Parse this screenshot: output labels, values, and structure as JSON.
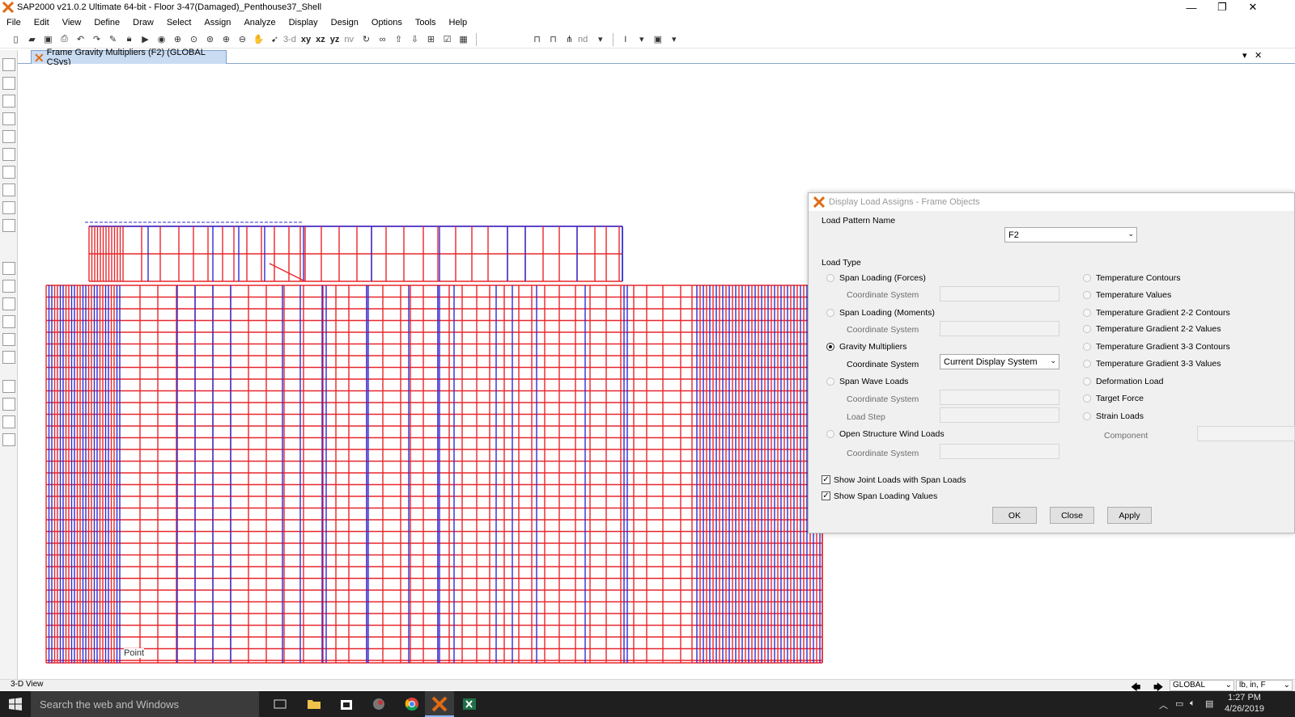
{
  "window": {
    "title": "SAP2000 v21.0.2 Ultimate 64-bit - Floor 3-47(Damaged)_Penthouse37_Shell",
    "minimize": "—",
    "restore": "❐",
    "close": "✕"
  },
  "menu": [
    "File",
    "Edit",
    "View",
    "Define",
    "Draw",
    "Select",
    "Assign",
    "Analyze",
    "Display",
    "Design",
    "Options",
    "Tools",
    "Help"
  ],
  "toolbar": {
    "view_3d": "3-d",
    "view_xy": "xy",
    "view_xz": "xz",
    "view_yz": "yz",
    "view_nv": "nv",
    "nd_label": "nd"
  },
  "tab": {
    "label": "Frame Gravity Multipliers (F2) (GLOBAL CSys)",
    "dropdown": "▾",
    "close": "✕"
  },
  "canvas": {
    "point_label": "Point"
  },
  "dialog": {
    "title": "Display Load Assigns - Frame Objects",
    "load_pattern_label": "Load Pattern Name",
    "load_pattern_value": "F2",
    "load_type_label": "Load Type",
    "span_forces": "Span Loading (Forces)",
    "span_moments": "Span Loading (Moments)",
    "gravity": "Gravity Multipliers",
    "span_wave": "Span Wave Loads",
    "open_wind": "Open Structure Wind Loads",
    "coord_system": "Coordinate System",
    "load_step": "Load Step",
    "coord_value": "Current Display System",
    "temp_contours": "Temperature Contours",
    "temp_values": "Temperature Values",
    "tg22_contours": "Temperature Gradient 2-2 Contours",
    "tg22_values": "Temperature Gradient 2-2 Values",
    "tg33_contours": "Temperature Gradient 3-3 Contours",
    "tg33_values": "Temperature Gradient 3-3 Values",
    "deformation": "Deformation Load",
    "target_force": "Target Force",
    "strain": "Strain Loads",
    "component": "Component",
    "show_joint": "Show Joint Loads with Span Loads",
    "show_span_values": "Show Span Loading Values",
    "ok": "OK",
    "close": "Close",
    "apply": "Apply"
  },
  "status": {
    "view": "3-D View",
    "coord": "GLOBAL",
    "units": "lb, in, F"
  },
  "taskbar": {
    "search": "Search the web and Windows",
    "time": "1:27 PM",
    "date": "4/26/2019"
  },
  "colors": {
    "frame_red": "#e8262b",
    "frame_blue": "#2d2bd6",
    "tab_bg": "#c9dcf2"
  }
}
